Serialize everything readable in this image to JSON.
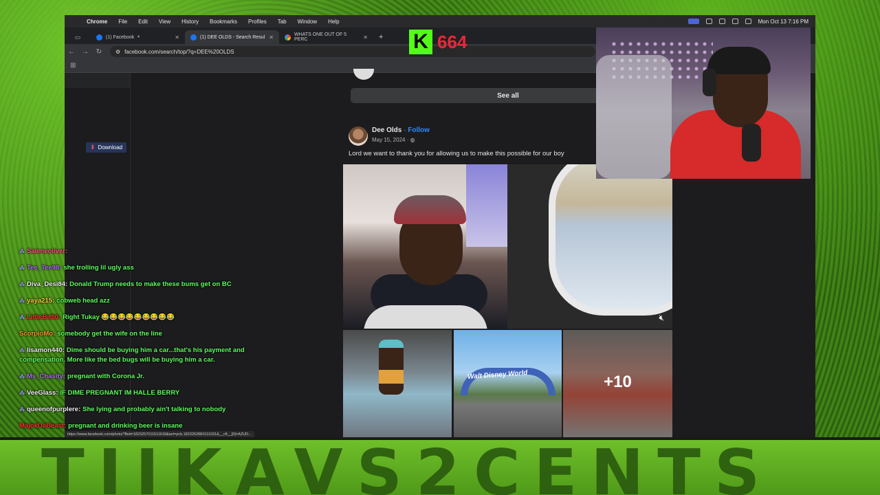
{
  "menubar": {
    "app": "Chrome",
    "items": [
      "File",
      "Edit",
      "View",
      "History",
      "Bookmarks",
      "Profiles",
      "Tab",
      "Window",
      "Help"
    ],
    "datetime": "Mon Oct 13  7:16 PM"
  },
  "tabs": [
    {
      "title": "(1) Facebook",
      "active": false
    },
    {
      "title": "(1) DEE OLDS - Search Resul",
      "active": true
    },
    {
      "title": "WHATS ONE OUT OF 5 PERC",
      "active": false
    }
  ],
  "address": {
    "url": "facebook.com/search/top/?q=DEE%20OLDS"
  },
  "download": {
    "label": "Download"
  },
  "feed": {
    "see_all": "See all",
    "post": {
      "author": "Dee Olds",
      "separator": "·",
      "follow": "Follow",
      "date": "May 15, 2024 ·",
      "text": "Lord we want to thank you for allowing us to make this possible for our boy",
      "photo_sign": "Walt Disney World",
      "more_photos": "+10"
    }
  },
  "status_url": "https://www.facebook.com/photo/?fbid=1823257011511618&set=pcb.1823262881511031&__cft__[0]=AZUD...",
  "overlay": {
    "kick_logo": "K",
    "kick_count": "664",
    "banner": "TIIKAVS2CENTS"
  },
  "chat": [
    {
      "user": "Saleneoliver:",
      "text": "",
      "user_color": "#ff5a8a",
      "badge": true
    },
    {
      "user": "Tee_Tee98:",
      "text": "she trolling lil ugly ass",
      "user_color": "#b46cff",
      "badge": true
    },
    {
      "user": "Diva_Desi84:",
      "text": "Donald Trump needs to make these bums get on BC",
      "user_color": "#f0f0f0",
      "badge": true
    },
    {
      "user": "yaya215:",
      "text": "cobweb head azz",
      "user_color": "#ffcf3a",
      "badge": true
    },
    {
      "user": "LittleBit50:",
      "text": "Right Tukay 😂😂😂😂😂😂😂😂😂",
      "user_color": "#ff3030",
      "badge": true
    },
    {
      "user": "ScorpioMo:",
      "text": "somebody get the wife on the line",
      "user_color": "#ff9a2a",
      "badge": false
    },
    {
      "user": "lisamon440:",
      "text": "Dime should be buying him a car...that's his payment and",
      "user_color": "#f0f0f0",
      "badge": true
    },
    {
      "user": "",
      "text": "compensation. More like the bed bugs will be buying him a car.",
      "user_color": "#f0f0f0",
      "badge": false
    },
    {
      "user": "Ms_Chasity:",
      "text": "pregnant with Corona Jr.",
      "user_color": "#b46cff",
      "badge": true
    },
    {
      "user": "VeeGlass:",
      "text": "IF DIME PREGNANT IM HALLE BERRY",
      "user_color": "#f0f0f0",
      "badge": true
    },
    {
      "user": "queenofpurplere:",
      "text": "She lying and probably ain't talking to nobody",
      "user_color": "#f0f0f0",
      "badge": true
    },
    {
      "user": "MajokDaBeast:",
      "text": "pregnant and drinking beer is insane",
      "user_color": "#ff3030",
      "badge": false
    }
  ],
  "icons": {
    "apple": "apple-icon",
    "back": "back-arrow-icon",
    "forward": "forward-arrow-icon",
    "reload": "reload-icon",
    "mute": "mute-icon",
    "globe": "globe-icon"
  },
  "colors": {
    "fb_blue": "#2d88ff",
    "kick_green": "#53fc18",
    "kick_red": "#e8283a",
    "chat_text": "#5dff5d"
  }
}
